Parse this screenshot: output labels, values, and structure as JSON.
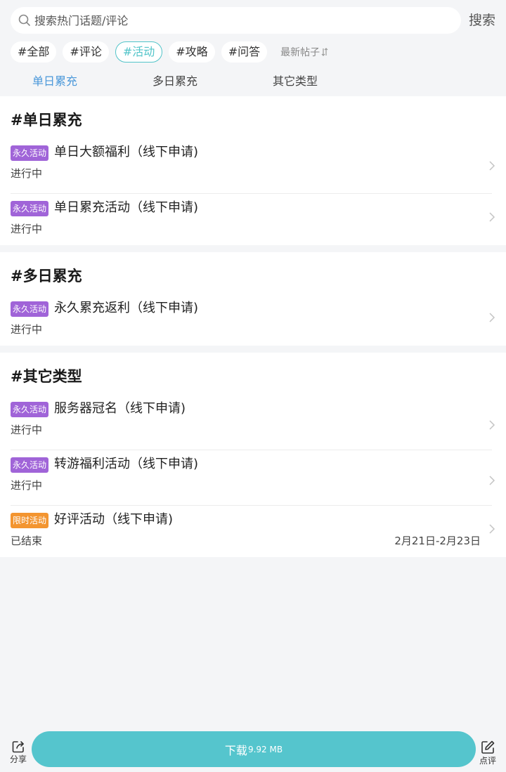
{
  "search": {
    "placeholder": "搜索热门话题/评论",
    "button_label": "搜索"
  },
  "tags": [
    {
      "label": "#全部",
      "active": false
    },
    {
      "label": "#评论",
      "active": false
    },
    {
      "label": "#活动",
      "active": true
    },
    {
      "label": "#攻略",
      "active": false
    },
    {
      "label": "#问答",
      "active": false
    }
  ],
  "sort_label": "最新帖子",
  "category_tabs": [
    {
      "label": "单日累充",
      "active": true
    },
    {
      "label": "多日累充",
      "active": false
    },
    {
      "label": "其它类型",
      "active": false
    }
  ],
  "sections": [
    {
      "title": "#单日累充",
      "items": [
        {
          "badge": "永久活动",
          "badge_type": "permanent",
          "title": "单日大额福利（线下申请)",
          "status": "进行中",
          "date": ""
        },
        {
          "badge": "永久活动",
          "badge_type": "permanent",
          "title": "单日累充活动（线下申请)",
          "status": "进行中",
          "date": ""
        }
      ]
    },
    {
      "title": "#多日累充",
      "items": [
        {
          "badge": "永久活动",
          "badge_type": "permanent",
          "title": "永久累充返利（线下申请)",
          "status": "进行中",
          "date": ""
        }
      ]
    },
    {
      "title": "#其它类型",
      "items": [
        {
          "badge": "永久活动",
          "badge_type": "permanent",
          "title": "服务器冠名（线下申请)",
          "status": "进行中",
          "date": ""
        },
        {
          "badge": "永久活动",
          "badge_type": "permanent",
          "title": "转游福利活动（线下申请)",
          "status": "进行中",
          "date": ""
        },
        {
          "badge": "限时活动",
          "badge_type": "limited",
          "title": "好评活动（线下申请)",
          "status": "已结束",
          "date": "2月21日-2月23日"
        }
      ]
    }
  ],
  "bottom": {
    "share_label": "分享",
    "download_label": "下载",
    "download_size": "9.92 MB",
    "review_label": "点评"
  },
  "colors": {
    "accent": "#52c4c9",
    "tab_active": "#4a98da",
    "badge_permanent": "#a064d8",
    "badge_limited": "#f39530",
    "download_button": "#55c5cd"
  },
  "icons": [
    "search-icon",
    "sort-icon",
    "chevron-right-icon",
    "share-icon",
    "edit-icon"
  ]
}
